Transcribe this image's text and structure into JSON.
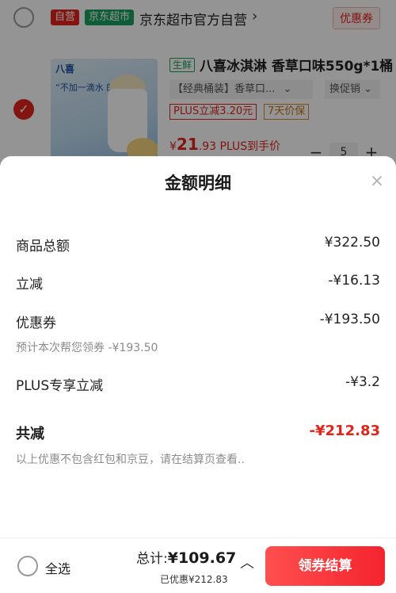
{
  "shop": {
    "tag_self": "自营",
    "tag_market": "京东超市",
    "name": "京东超市官方自营",
    "arrow": "›",
    "coupon_label": "优惠券"
  },
  "product": {
    "checked_mark": "✓",
    "image_brand": "八喜",
    "image_slogan": "“不加一滴水 的冰淇淋”",
    "fresh_tag": "生鲜",
    "title": "八喜冰淇淋 香草口味550g*1桶",
    "spec": "【经典桶装】香草口...",
    "spec_chevron": "⌄",
    "promo_select": "换促销",
    "promo_chevron": "⌄",
    "plus_tag": "PLUS立减3.20元",
    "return_tag": "7天价保",
    "price_symbol": "¥",
    "price_int": "21",
    "price_dec": ".93",
    "price_suffix": " PLUS到手价",
    "qty_minus": "−",
    "quantity": "5",
    "qty_plus": "+"
  },
  "sheet": {
    "title": "金额明细",
    "close": "×",
    "rows": [
      {
        "label": "商品总额",
        "value": "¥322.50"
      },
      {
        "label": "立减",
        "value": "-¥16.13"
      },
      {
        "label": "优惠券",
        "value": "-¥193.50",
        "note": "预计本次帮您领券 -¥193.50"
      },
      {
        "label": "PLUS专享立减",
        "value": "-¥3.2"
      },
      {
        "label": "共减",
        "value": "-¥212.83"
      }
    ],
    "footnote": "以上优惠不包含红包和京豆，请在结算页查看.."
  },
  "bottom": {
    "select_all": "全选",
    "total_label": "总计:",
    "total_value": "¥109.67",
    "saved": "已优惠¥212.83",
    "chevron": "︿",
    "checkout": "领券结算"
  },
  "colors": {
    "accent": "#e2231a",
    "jd_green": "#19a15f"
  }
}
